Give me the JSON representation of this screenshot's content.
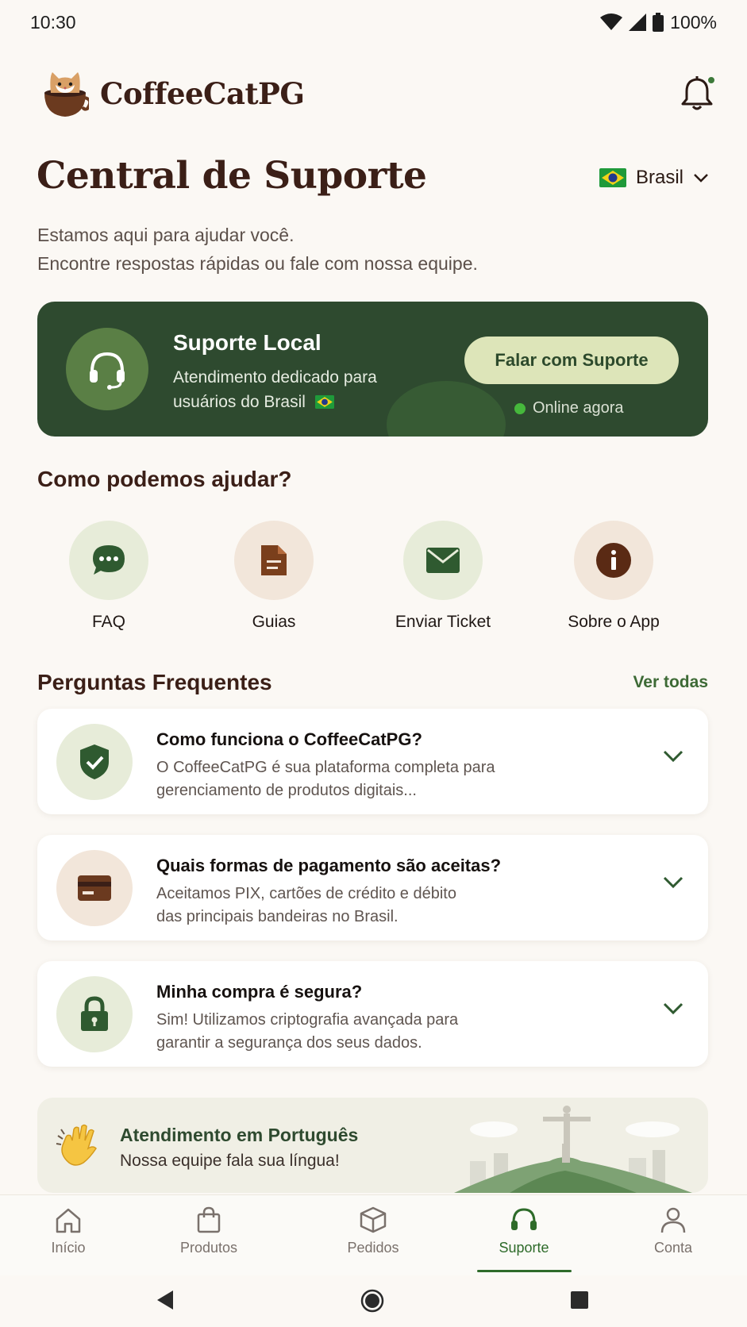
{
  "status_bar": {
    "time": "10:30",
    "battery": "100%"
  },
  "header": {
    "app_name": "CoffeeCatPG"
  },
  "page": {
    "title": "Central de Suporte",
    "country": "Brasil",
    "subtitle_line1": "Estamos aqui para ajudar você.",
    "subtitle_line2": "Encontre respostas rápidas ou fale com nossa equipe."
  },
  "support_card": {
    "title": "Suporte Local",
    "desc_line1": "Atendimento dedicado para",
    "desc_line2": "usuários do Brasil",
    "button_label": "Falar com Suporte",
    "status": "Online agora"
  },
  "help": {
    "title": "Como podemos ajudar?",
    "items": [
      {
        "label": "FAQ",
        "icon": "chat-bubble-icon"
      },
      {
        "label": "Guias",
        "icon": "document-icon"
      },
      {
        "label": "Enviar Ticket",
        "icon": "envelope-icon"
      },
      {
        "label": "Sobre o App",
        "icon": "info-icon"
      }
    ]
  },
  "faq": {
    "title": "Perguntas Frequentes",
    "see_all": "Ver todas",
    "items": [
      {
        "question": "Como funciona o CoffeeCatPG?",
        "answer_line1": "O CoffeeCatPG é sua plataforma completa para",
        "answer_line2": "gerenciamento de produtos digitais...",
        "icon": "shield-check-icon"
      },
      {
        "question": "Quais formas de pagamento são aceitas?",
        "answer_line1": "Aceitamos PIX, cartões de crédito e débito",
        "answer_line2": "das principais bandeiras no Brasil.",
        "icon": "credit-card-icon"
      },
      {
        "question": "Minha compra é segura?",
        "answer_line1": "Sim! Utilizamos criptografia avançada para",
        "answer_line2": "garantir a segurança dos seus dados.",
        "icon": "lock-icon"
      }
    ]
  },
  "banner": {
    "title": "Atendimento em Português",
    "subtitle": "Nossa equipe fala sua língua!"
  },
  "bottom_nav": {
    "items": [
      {
        "label": "Início",
        "icon": "home-icon"
      },
      {
        "label": "Produtos",
        "icon": "shopping-bag-icon"
      },
      {
        "label": "Pedidos",
        "icon": "box-icon"
      },
      {
        "label": "Suporte",
        "icon": "headset-icon",
        "active": true
      },
      {
        "label": "Conta",
        "icon": "user-icon"
      }
    ]
  },
  "colors": {
    "primary_green": "#2e4a2f",
    "accent_green": "#3d7a3a",
    "brown": "#3b1f17",
    "background": "#fbf8f4"
  }
}
